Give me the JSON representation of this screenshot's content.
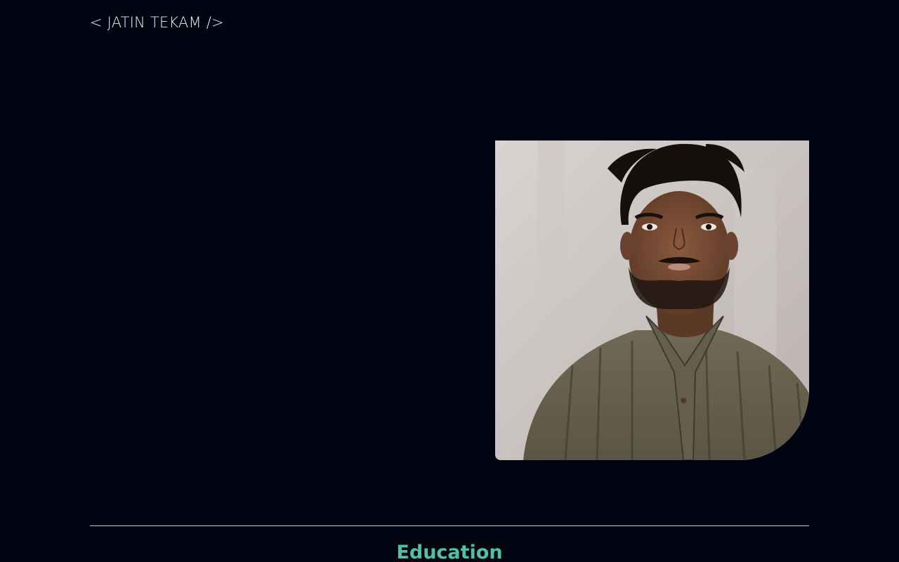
{
  "header": {
    "brand": "< JATIN TEKAM />"
  },
  "hero": {
    "photo_icon": "portrait-photo"
  },
  "sections": {
    "education_title": "Education"
  },
  "colors": {
    "background": "#020412",
    "brand_text": "#e9ecf2",
    "accent": "#4fc2a4",
    "divider": "#c7ccd8"
  }
}
